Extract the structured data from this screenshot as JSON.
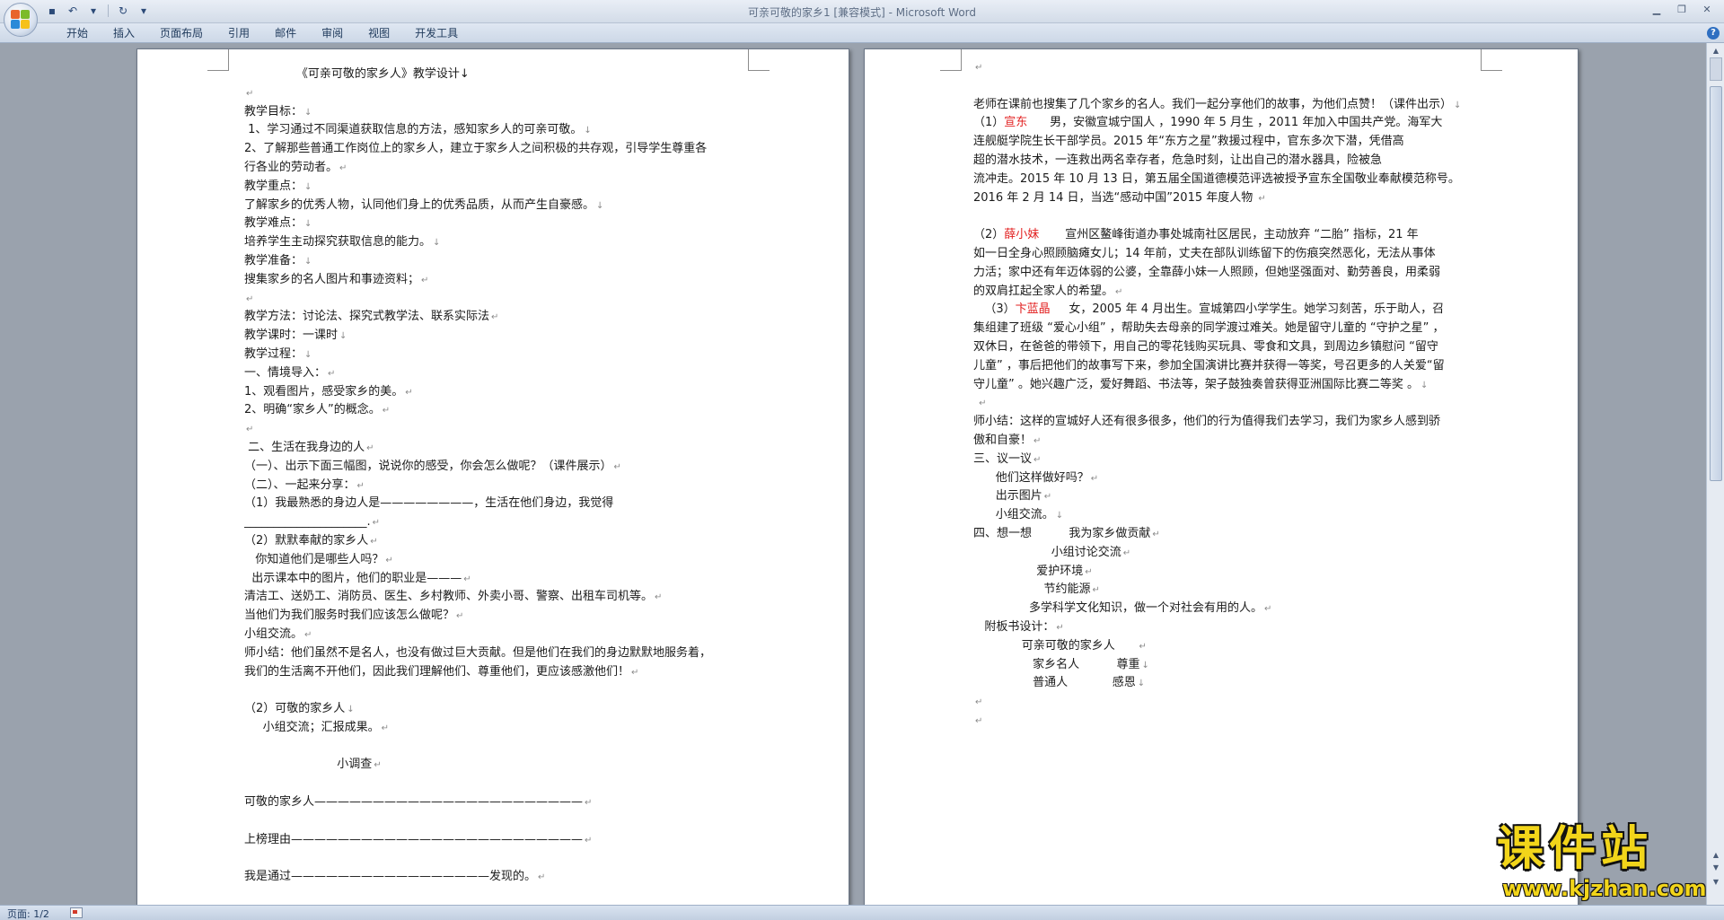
{
  "window": {
    "title": "可亲可敬的家乡1 [兼容模式] - Microsoft Word"
  },
  "quick_access": [
    {
      "icon": "save-icon",
      "glyph": "▪"
    },
    {
      "icon": "undo-icon",
      "glyph": "↶"
    },
    {
      "icon": "undo-dropdown-icon",
      "glyph": "▾"
    },
    {
      "icon": "redo-icon",
      "glyph": "↻"
    },
    {
      "icon": "customize-qat-icon",
      "glyph": "▾"
    }
  ],
  "ribbon": {
    "tabs": [
      "开始",
      "插入",
      "页面布局",
      "引用",
      "邮件",
      "审阅",
      "视图",
      "开发工具"
    ]
  },
  "status": {
    "page_count": "页面: 1/2"
  },
  "watermark": {
    "main": "课件站",
    "url": "www.kjzhan.com"
  },
  "page1": {
    "lines": [
      {
        "t": "              《可亲可敬的家乡人》教学设计↓",
        "m": ""
      },
      {
        "t": "",
        "m": "↵"
      },
      {
        "t": "教学目标：",
        "m": "↓"
      },
      {
        "t": " 1、学习通过不同渠道获取信息的方法，感知家乡人的可亲可敬。",
        "m": "↓"
      },
      {
        "t": "2、了解那些普通工作岗位上的家乡人，建立于家乡人之间积极的共存观，引导学生尊重各",
        "m": ""
      },
      {
        "t": "行各业的劳动者。",
        "m": "↵"
      },
      {
        "t": "教学重点：",
        "m": "↓"
      },
      {
        "t": "了解家乡的优秀人物，认同他们身上的优秀品质，从而产生自豪感。",
        "m": "↓"
      },
      {
        "t": "教学难点：",
        "m": "↓"
      },
      {
        "t": "培养学生主动探究获取信息的能力。",
        "m": "↓"
      },
      {
        "t": "教学准备：",
        "m": "↓"
      },
      {
        "t": "搜集家乡的名人图片和事迹资料；",
        "m": "↵"
      },
      {
        "t": "",
        "m": "↵"
      },
      {
        "t": "教学方法：讨论法、探究式教学法、联系实际法",
        "m": "↵"
      },
      {
        "t": "教学课时：一课时",
        "m": "↓"
      },
      {
        "t": "教学过程：",
        "m": "↓"
      },
      {
        "t": "一、情境导入：",
        "m": "↵"
      },
      {
        "t": "1、观看图片，感受家乡的美。",
        "m": "↵"
      },
      {
        "t": "2、明确“家乡人”的概念。",
        "m": "↵"
      },
      {
        "t": "",
        "m": "↵"
      },
      {
        "t": " 二、生活在我身边的人",
        "m": "↵"
      },
      {
        "t": "（一）、出示下面三幅图，说说你的感受，你会怎么做呢？（课件展示）",
        "m": "↵"
      },
      {
        "t": "（二）、一起来分享：",
        "m": "↵"
      },
      {
        "t": "（1）我最熟悉的身边人是————————，生活在他们身边，我觉得",
        "m": ""
      },
      {
        "t": "_____________________.",
        "m": "↵"
      },
      {
        "t": "（2）默默奉献的家乡人",
        "m": "↵"
      },
      {
        "t": "   你知道他们是哪些人吗？",
        "m": "↵"
      },
      {
        "t": "  出示课本中的图片，他们的职业是———",
        "m": "↵"
      },
      {
        "t": "清洁工、送奶工、消防员、医生、乡村教师、外卖小哥、警察、出租车司机等。",
        "m": "↵"
      },
      {
        "t": "当他们为我们服务时我们应该怎么做呢？",
        "m": "↵"
      },
      {
        "t": "小组交流。",
        "m": "↵"
      },
      {
        "t": "师小结：他们虽然不是名人，也没有做过巨大贡献。但是他们在我们的身边默默地服务着，",
        "m": ""
      },
      {
        "t": "我们的生活离不开他们，因此我们理解他们、尊重他们，更应该感激他们！",
        "m": "↵"
      },
      {
        "t": "",
        "m": ""
      },
      {
        "t": "（2）可敬的家乡人",
        "m": "↓"
      },
      {
        "t": "     小组交流；汇报成果。",
        "m": "↵"
      },
      {
        "t": "",
        "m": ""
      },
      {
        "t": "                         小调查",
        "m": "↵"
      },
      {
        "t": "",
        "m": ""
      },
      {
        "t": "可敬的家乡人———————————————————————",
        "m": "↵"
      },
      {
        "t": "",
        "m": ""
      },
      {
        "t": "上榜理由—————————————————————————",
        "m": "↵"
      },
      {
        "t": "",
        "m": ""
      },
      {
        "t": "我是通过—————————————————发现的。",
        "m": "↵"
      },
      {
        "t": "",
        "m": ""
      },
      {
        "t": "",
        "m": "↵"
      }
    ]
  },
  "page2": {
    "lines": [
      {
        "t": "",
        "m": "↵"
      },
      {
        "t": "",
        "m": ""
      },
      {
        "t": "老师在课前也搜集了几个家乡的名人。我们一起分享他们的故事，为他们点赞！（课件出示）",
        "m": "↓"
      },
      {
        "t": "（1）",
        "r": "宣东",
        "t2": "      男，安徽宣城宁国人 ，1990 年 5 月生 ，2011 年加入中国共产党。海军大",
        "m": ""
      },
      {
        "t": "连舰艇学院生长干部学员。2015 年“东方之星”救援过程中，官东多次下潜，凭借高",
        "m": ""
      },
      {
        "t": "超的潜水技术，一连救出两名幸存者，危急时刻，让出自己的潜水器具，险被急",
        "m": ""
      },
      {
        "t": "流冲走。2015 年 10 月 13 日，第五届全国道德模范评选被授予宣东全国敬业奉献模范称号。",
        "m": ""
      },
      {
        "t": "2016 年 2 月 14 日，当选“感动中国”2015 年度人物 ",
        "m": "↵"
      },
      {
        "t": "",
        "m": ""
      },
      {
        "t": "（2）",
        "r": "薛小妹",
        "t2": "       宣州区鳌峰街道办事处城南社区居民，主动放弃 “二胎” 指标，21 年",
        "m": ""
      },
      {
        "t": "如一日全身心照顾脑瘫女儿；14 年前，丈夫在部队训练留下的伤痕突然恶化，无法从事体",
        "m": ""
      },
      {
        "t": "力活；家中还有年迈体弱的公婆，全靠薛小妹一人照顾，但她坚强面对、勤劳善良，用柔弱",
        "m": ""
      },
      {
        "t": "的双肩扛起全家人的希望。",
        "m": "↵"
      },
      {
        "t": "   （3）",
        "r": "卞蓝晶",
        "t2": "     女，2005 年 4 月出生。宣城第四小学学生。她学习刻苦，乐于助人，召",
        "m": ""
      },
      {
        "t": "集组建了班级 “爱心小组” ，帮助失去母亲的同学渡过难关。她是留守儿童的 “守护之星” ，",
        "m": ""
      },
      {
        "t": "双休日，在爸爸的带领下，用自己的零花钱购买玩具、零食和文具，到周边乡镇慰问 “留守",
        "m": ""
      },
      {
        "t": "儿童” ，事后把他们的故事写下来，参加全国演讲比赛并获得一等奖，号召更多的人关爱“留",
        "m": ""
      },
      {
        "t": "守儿童” 。她兴趣广泛，爱好舞蹈、书法等，架子鼓独奏曾获得亚洲国际比赛二等奖 。",
        "m": "↓"
      },
      {
        "t": " ",
        "m": "↵"
      },
      {
        "t": "师小结：这样的宣城好人还有很多很多，他们的行为值得我们去学习，我们为家乡人感到骄",
        "m": ""
      },
      {
        "t": "傲和自豪！",
        "m": "↵"
      },
      {
        "t": "三、议一议",
        "m": "↵"
      },
      {
        "t": "      他们这样做好吗？",
        "m": "↵"
      },
      {
        "t": "      出示图片",
        "m": "↵"
      },
      {
        "t": "      小组交流。",
        "m": "↓"
      },
      {
        "t": "四、想一想          我为家乡做贡献",
        "m": "↵"
      },
      {
        "t": "                     小组讨论交流",
        "m": "↵"
      },
      {
        "t": "                 爱护环境",
        "m": "↵"
      },
      {
        "t": "                   节约能源",
        "m": "↵"
      },
      {
        "t": "               多学科学文化知识，做一个对社会有用的人。",
        "m": "↵"
      },
      {
        "t": "   附板书设计：",
        "m": "↵"
      },
      {
        "t": "             可亲可敬的家乡人      ",
        "m": "↵"
      },
      {
        "t": "                家乡名人          尊重",
        "m": "↓"
      },
      {
        "t": "                普通人            感恩",
        "m": "↓"
      },
      {
        "t": "",
        "m": "↵"
      },
      {
        "t": "",
        "m": "↵"
      }
    ]
  }
}
